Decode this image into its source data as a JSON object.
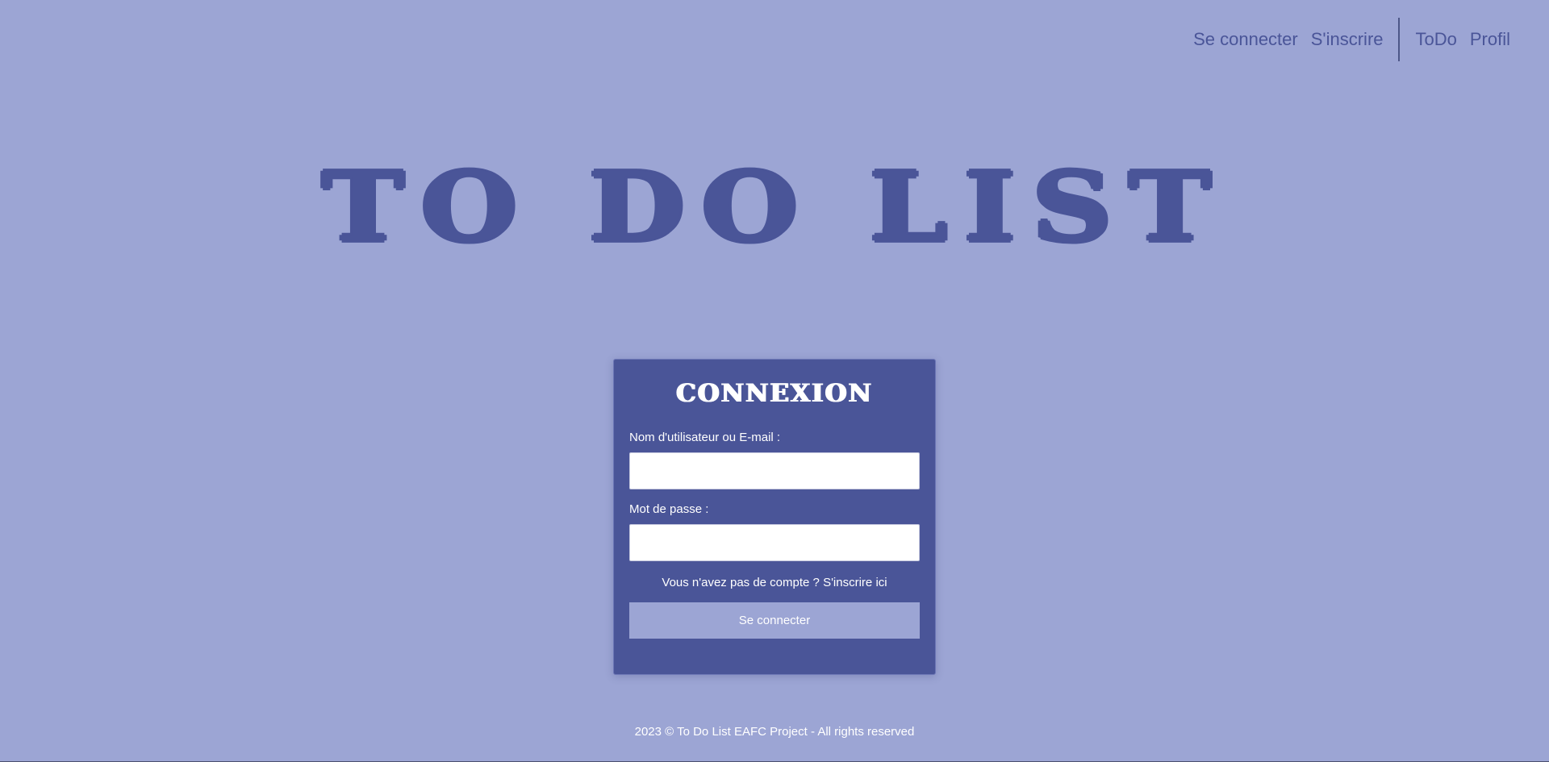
{
  "nav": {
    "login": "Se connecter",
    "register": "S'inscrire",
    "todo": "ToDo",
    "profile": "Profil"
  },
  "hero": {
    "title": "To Do List"
  },
  "login_form": {
    "title": "Connexion",
    "username_label": "Nom d'utilisateur ou E-mail :",
    "username_value": "",
    "password_label": "Mot de passe :",
    "password_value": "",
    "no_account_text": "Vous n'avez pas de compte ?",
    "signup_link": "S'inscrire ici",
    "submit": "Se connecter"
  },
  "footer": {
    "text": "2023 © To Do List EAFC Project - All rights reserved"
  },
  "colors": {
    "background": "#9ca5d4",
    "accent": "#4a5598",
    "text_light": "#ffffff"
  }
}
